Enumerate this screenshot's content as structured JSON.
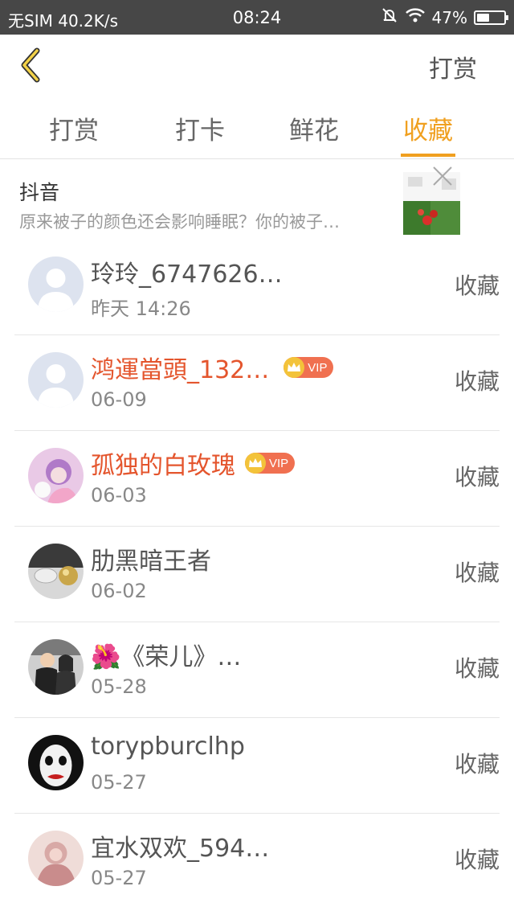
{
  "status_bar": {
    "carrier": "无SIM",
    "speed": "40.2K/s",
    "time": "08:24",
    "battery": "47%",
    "battery_level": 0.47,
    "icons": [
      "mute-bell-icon",
      "wifi-icon",
      "battery-icon"
    ]
  },
  "header": {
    "back_icon": "chevron-left-icon",
    "action_label": "打赏",
    "accent_color": "#f0a020"
  },
  "tabs": [
    {
      "label": "打赏",
      "active": false
    },
    {
      "label": "打卡",
      "active": false
    },
    {
      "label": "鲜花",
      "active": false
    },
    {
      "label": "收藏",
      "active": true
    }
  ],
  "ad": {
    "title": "抖音",
    "description": "原来被子的颜色还会影响睡眠？你的被子…",
    "close_icon": "close-icon"
  },
  "list": [
    {
      "name": "玲玲_6747626…",
      "date": "昨天 14:26",
      "action": "收藏",
      "vip": false
    },
    {
      "name": "鸿運當頭_132…",
      "date": "06-09",
      "action": "收藏",
      "vip": true,
      "vip_label": "VIP"
    },
    {
      "name": "孤独的白玫瑰",
      "date": "06-03",
      "action": "收藏",
      "vip": true,
      "vip_label": "VIP"
    },
    {
      "name": "肋黑暗王者",
      "date": "06-02",
      "action": "收藏",
      "vip": false
    },
    {
      "name": "🌺《荣儿》…",
      "date": "05-28",
      "action": "收藏",
      "vip": false
    },
    {
      "name": "torypburclhp",
      "date": "05-27",
      "action": "收藏",
      "vip": false
    },
    {
      "name": "宜水双欢_594…",
      "date": "05-27",
      "action": "收藏",
      "vip": false
    }
  ]
}
